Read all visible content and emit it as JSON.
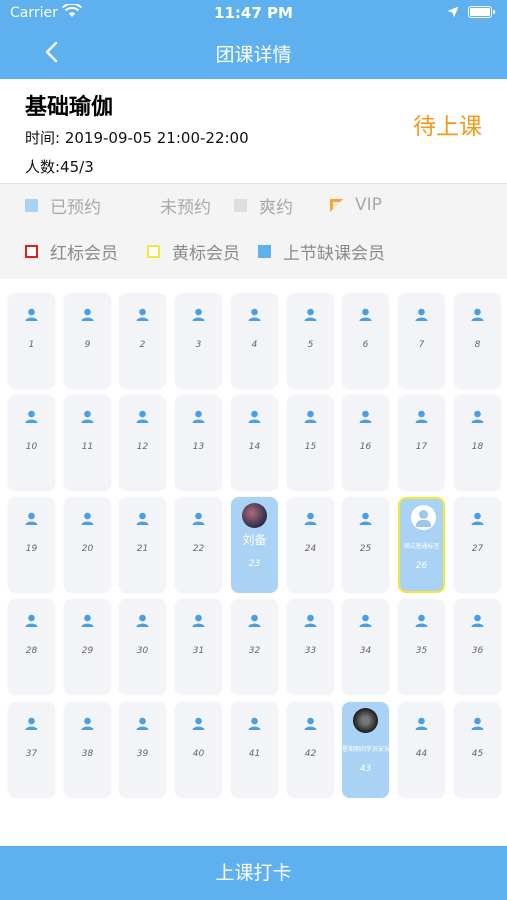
{
  "status_bar": {
    "carrier": "Carrier",
    "time": "11:47 PM"
  },
  "nav": {
    "title": "团课详情",
    "back_icon": "chevron-left-icon"
  },
  "course": {
    "name": "基础瑜伽",
    "time": "时间: 2019-09-05 21:00-22:00",
    "count": "人数:45/3",
    "status": "待上课",
    "status_color": "#f39a1a"
  },
  "legend": [
    {
      "label": "已预约",
      "color": "#a9d3f5"
    },
    {
      "label": "未预约",
      "color": "#f4f4f4"
    },
    {
      "label": "爽约",
      "color": "#dedede"
    },
    {
      "label": "VIP",
      "color": "#f4a63c"
    },
    {
      "label": "红标会员",
      "color": "#e02020"
    },
    {
      "label": "黄标会员",
      "color": "#f0ea3a"
    },
    {
      "label": "上节缺课会员",
      "color": "#5fb0ef"
    }
  ],
  "seats": [
    [
      "1",
      "9",
      "2",
      "3",
      "4",
      "5",
      "6",
      "7",
      "8"
    ],
    [
      "10",
      "11",
      "12",
      "13",
      "14",
      "15",
      "16",
      "17",
      "18"
    ],
    [
      "19",
      "20",
      "21",
      "22",
      "23",
      "24",
      "25",
      "26",
      "27"
    ],
    [
      "28",
      "29",
      "30",
      "31",
      "32",
      "33",
      "34",
      "35",
      "36"
    ],
    [
      "37",
      "38",
      "39",
      "40",
      "41",
      "42",
      "43",
      "44",
      "45"
    ]
  ],
  "booked": {
    "23": "刘备",
    "26": "测试普通标签",
    "43": "星期期间学员安安"
  },
  "checkin_label": "上课打卡",
  "colors": {
    "primary": "#5fb0ef",
    "booked": "#aad2f4",
    "yellow_border": "#f0ea3a"
  }
}
